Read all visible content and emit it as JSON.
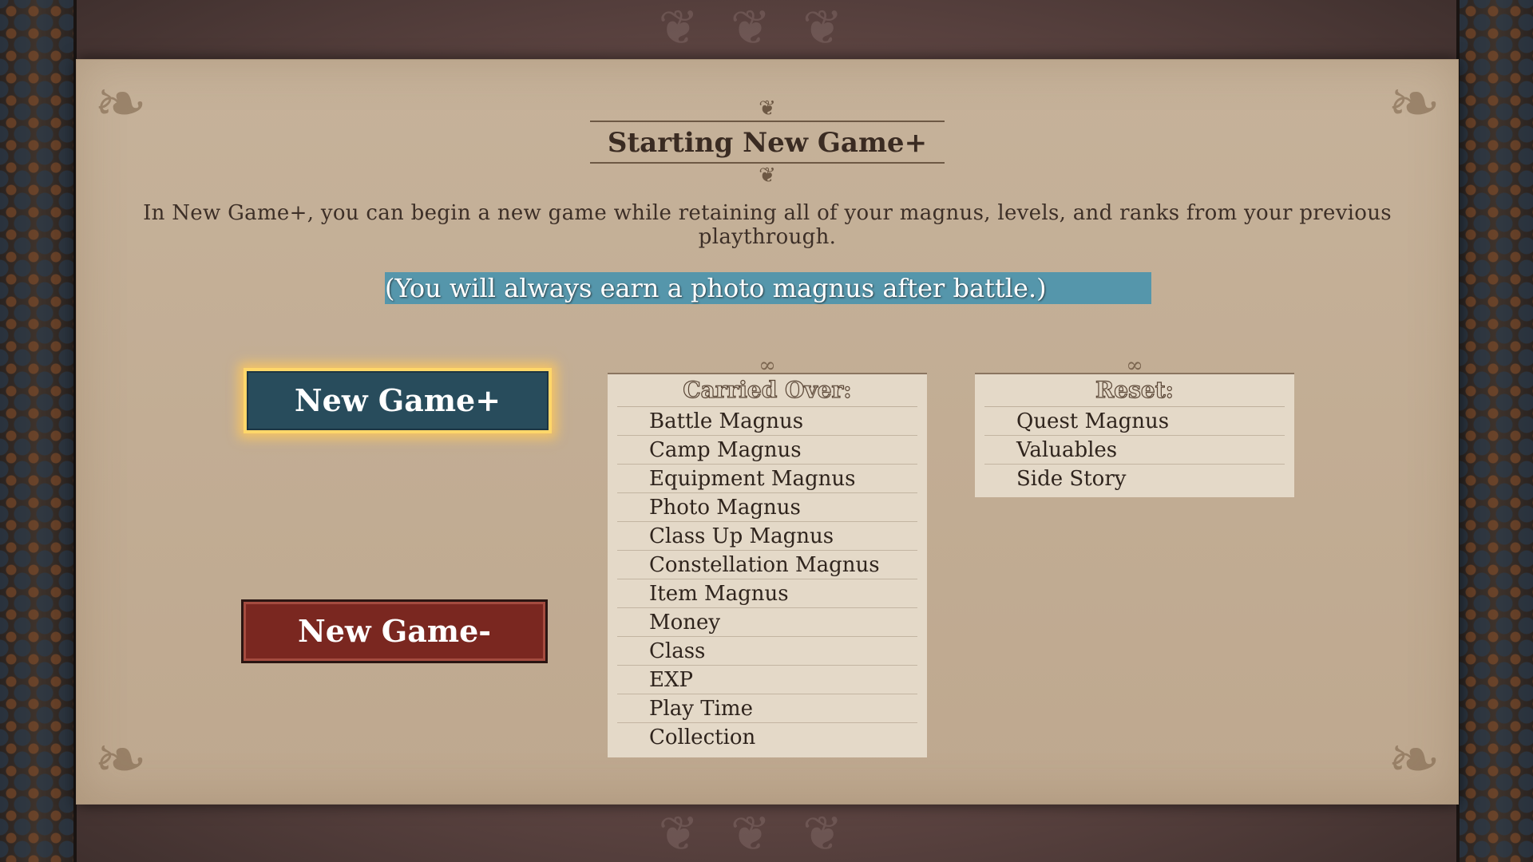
{
  "title": "Starting New Game+",
  "description": "In New Game+, you can begin a new game while retaining all of your magnus, levels, and ranks from your previous playthrough.",
  "highlight_text": "(You will always earn a photo magnus after battle.)",
  "buttons": {
    "new_game_plus": "New Game+",
    "new_game_minus": "New Game-"
  },
  "carried_over": {
    "header": "Carried Over:",
    "items": [
      "Battle Magnus",
      "Camp Magnus",
      "Equipment Magnus",
      "Photo Magnus",
      "Class Up Magnus",
      "Constellation Magnus",
      "Item Magnus",
      "Money",
      "Class",
      "EXP",
      "Play Time",
      "Collection"
    ]
  },
  "reset": {
    "header": "Reset:",
    "items": [
      "Quest Magnus",
      "Valuables",
      "Side Story"
    ]
  },
  "colors": {
    "highlight_bg": "#5596ab",
    "new_game_plus_bg": "#284c5c",
    "new_game_plus_glow": "#ffd76a",
    "new_game_minus_bg": "#7a2720",
    "parchment": "#c4b097"
  }
}
